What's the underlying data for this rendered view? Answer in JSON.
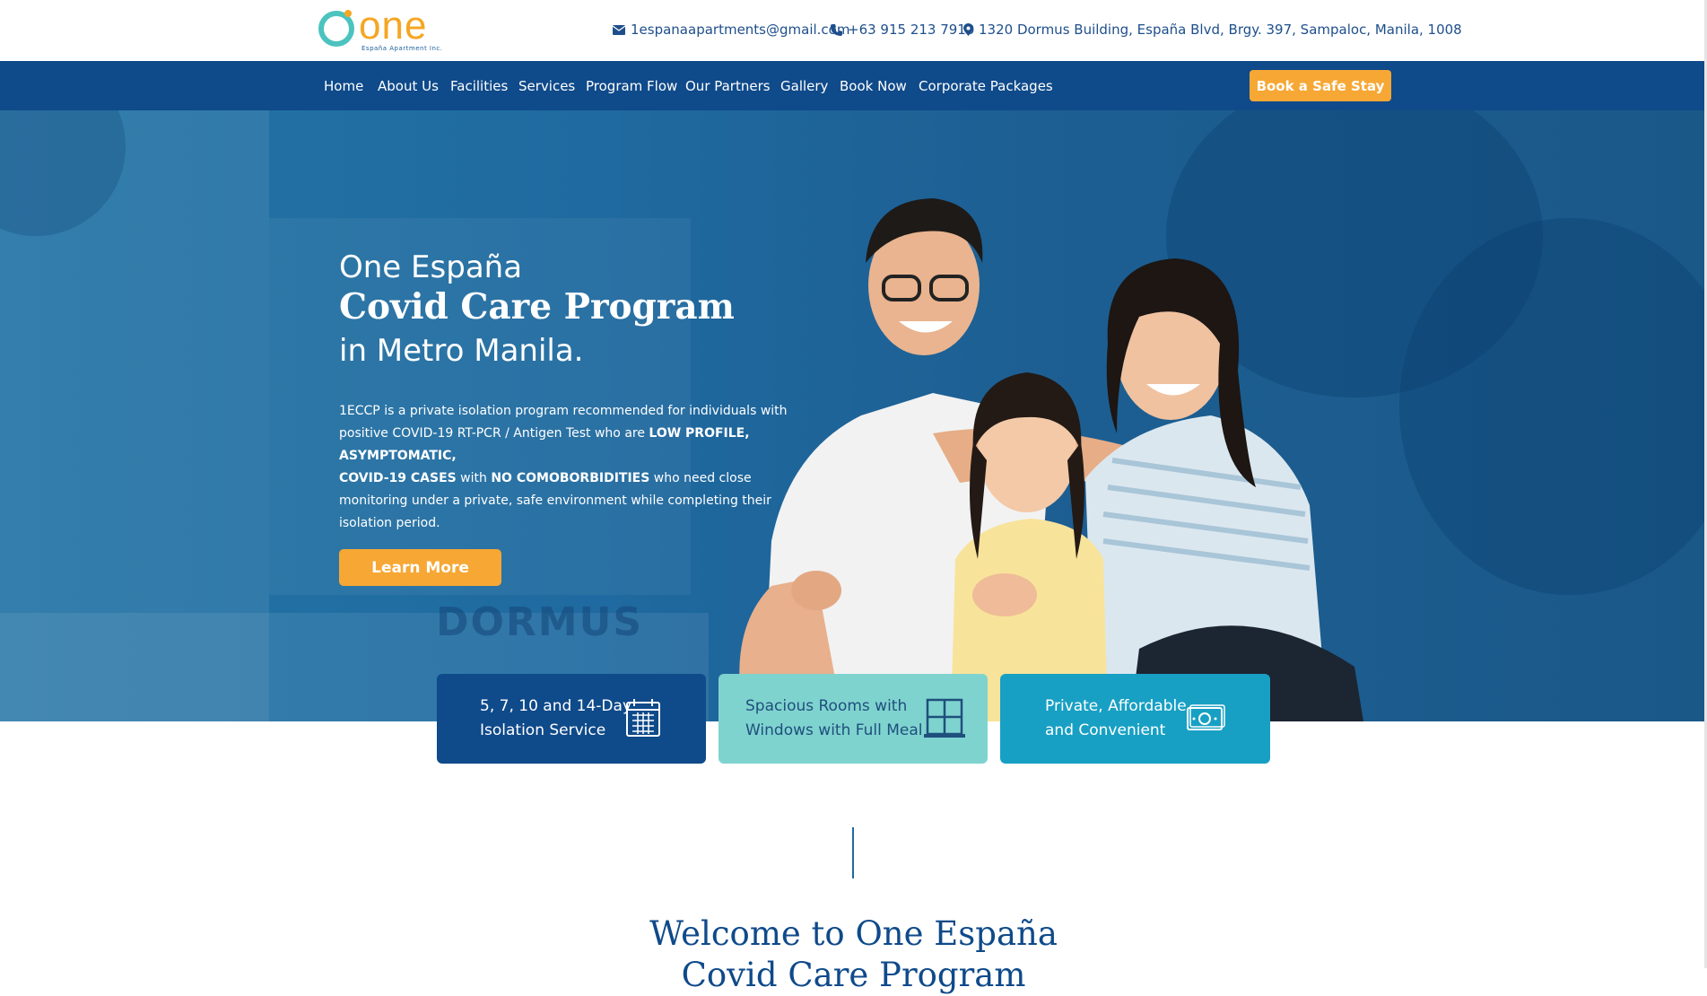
{
  "brand": {
    "logo_word": "one",
    "logo_sub": "España Apartment Inc."
  },
  "contact": {
    "email": "1espanaapartments@gmail.com",
    "phone": "+63 915 213 7910",
    "address": "1320 Dormus Building, España Blvd, Brgy. 397, Sampaloc, Manila, 1008"
  },
  "nav": {
    "items": [
      "Home",
      "About Us",
      "Facilities",
      "Services",
      "Program Flow",
      "Our Partners",
      "Gallery",
      "Book Now",
      "Corporate Packages"
    ],
    "cta": "Book a Safe Stay"
  },
  "hero": {
    "line1": "One España",
    "line2": "Covid Care Program",
    "line3": "in Metro Manila.",
    "desc": {
      "p1": "1ECCP is a private isolation program recommended for individuals with positive COVID-19 RT-PCR / Antigen Test who are ",
      "b1": "LOW PROFILE, ASYMPTOMATIC,",
      "b2": "COVID-19 CASES",
      "p2": " with ",
      "b3": "NO COMOBORBIDITIES",
      "p3": " who need close monitoring under a private, safe environment while completing their isolation period."
    },
    "button": "Learn More",
    "building_sign": "DORMUS"
  },
  "cards": [
    {
      "line1": "5, 7, 10 and 14-Day",
      "line2": "Isolation Service",
      "icon": "calendar-icon"
    },
    {
      "line1": "Spacious Rooms with",
      "line2": "Windows with Full Meal",
      "icon": "window-icon"
    },
    {
      "line1": "Private, Affordable",
      "line2": "and Convenient",
      "icon": "money-icon"
    }
  ],
  "welcome": {
    "line1": "Welcome to One España",
    "line2": "Covid Care Program"
  },
  "colors": {
    "navy": "#0f4a8a",
    "orange": "#f7a734",
    "teal": "#7fd3cf",
    "cyan": "#18a0c4"
  }
}
